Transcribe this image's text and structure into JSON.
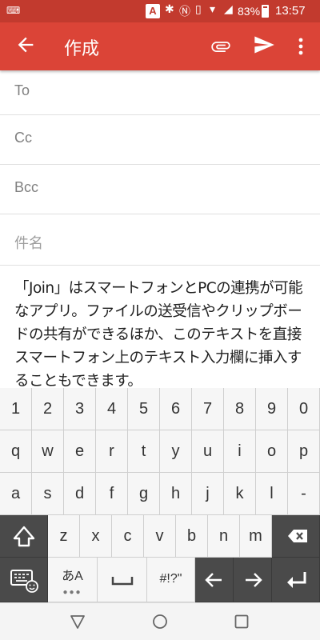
{
  "status_bar": {
    "battery_text": "83%",
    "time": "13:57",
    "ime_badge": "A"
  },
  "app_bar": {
    "title": "作成",
    "color": "#db4437"
  },
  "compose": {
    "to_label": "To",
    "cc_label": "Cc",
    "bcc_label": "Bcc",
    "subject_placeholder": "件名",
    "body": "「Join」はスマートフォンとPCの連携が可能なアプリ。ファイルの送受信やクリップボードの共有ができるほか、このテキストを直接スマートフォン上のテキスト入力欄に挿入することもできます。"
  },
  "keyboard": {
    "row_numbers": [
      "1",
      "2",
      "3",
      "4",
      "5",
      "6",
      "7",
      "8",
      "9",
      "0"
    ],
    "row_q": [
      "q",
      "w",
      "e",
      "r",
      "t",
      "y",
      "u",
      "i",
      "o",
      "p"
    ],
    "row_a": [
      "a",
      "s",
      "d",
      "f",
      "g",
      "h",
      "j",
      "k",
      "l",
      "-"
    ],
    "row_z": [
      "z",
      "x",
      "c",
      "v",
      "b",
      "n",
      "m"
    ],
    "mode_key": "あA",
    "symbols_key": "#!?\""
  },
  "icons": {
    "back": "arrow-back-icon",
    "attach": "paperclip-icon",
    "send": "send-icon",
    "more": "more-vert-icon",
    "shift": "shift-icon",
    "backspace": "backspace-icon",
    "keyboard_settings": "keyboard-emoji-icon",
    "space": "space-icon",
    "cursor_left": "arrow-left-icon",
    "cursor_right": "arrow-right-icon",
    "enter": "enter-icon",
    "nav_back": "nav-back-icon",
    "nav_home": "nav-home-icon",
    "nav_recents": "nav-recents-icon"
  }
}
